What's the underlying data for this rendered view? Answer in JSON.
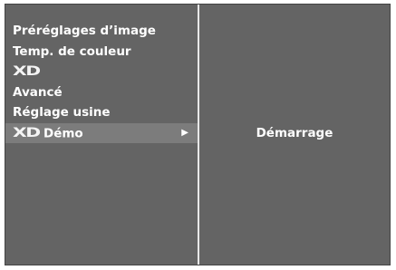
{
  "menu": {
    "items": [
      {
        "label": "Préréglages d’image"
      },
      {
        "label": "Temp. de couleur"
      },
      {
        "logo": "XD"
      },
      {
        "label": "Avancé"
      },
      {
        "label": "Réglage usine"
      },
      {
        "logo": "XD",
        "label": "Démo",
        "selected": true,
        "arrow": "▶"
      }
    ]
  },
  "submenu": {
    "items": [
      {
        "label": "Démarrage"
      }
    ]
  },
  "colors": {
    "panel": "#646464",
    "selected_row": "#7c7c7c",
    "divider": "#e8e8e8",
    "text": "#ffffff"
  }
}
